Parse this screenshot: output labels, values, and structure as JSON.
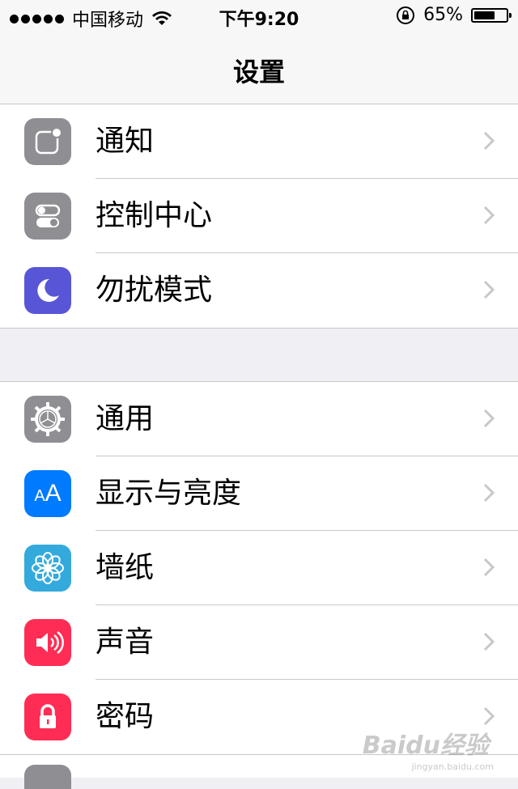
{
  "status_bar": {
    "carrier": "中国移动",
    "time": "下午9:20",
    "battery_percent_text": "65%",
    "battery_level": 0.65
  },
  "nav": {
    "title": "设置"
  },
  "groups": [
    {
      "items": [
        {
          "label": "通知",
          "icon": "notifications-icon",
          "color": "#8e8e93"
        },
        {
          "label": "控制中心",
          "icon": "control-center-icon",
          "color": "#8e8e93"
        },
        {
          "label": "勿扰模式",
          "icon": "moon-icon",
          "color": "#5856d6"
        }
      ]
    },
    {
      "items": [
        {
          "label": "通用",
          "icon": "gear-icon",
          "color": "#8e8e93"
        },
        {
          "label": "显示与亮度",
          "icon": "display-brightness-icon",
          "color": "#007aff",
          "icon_text": "AA"
        },
        {
          "label": "墙纸",
          "icon": "wallpaper-flower-icon",
          "color": "#34aadc"
        },
        {
          "label": "声音",
          "icon": "speaker-icon",
          "color": "#ff2d55"
        },
        {
          "label": "密码",
          "icon": "lock-icon",
          "color": "#ff2d55"
        }
      ]
    }
  ],
  "watermark": {
    "text": "Baidu经验",
    "subtext": "jingyan.baidu.com"
  }
}
